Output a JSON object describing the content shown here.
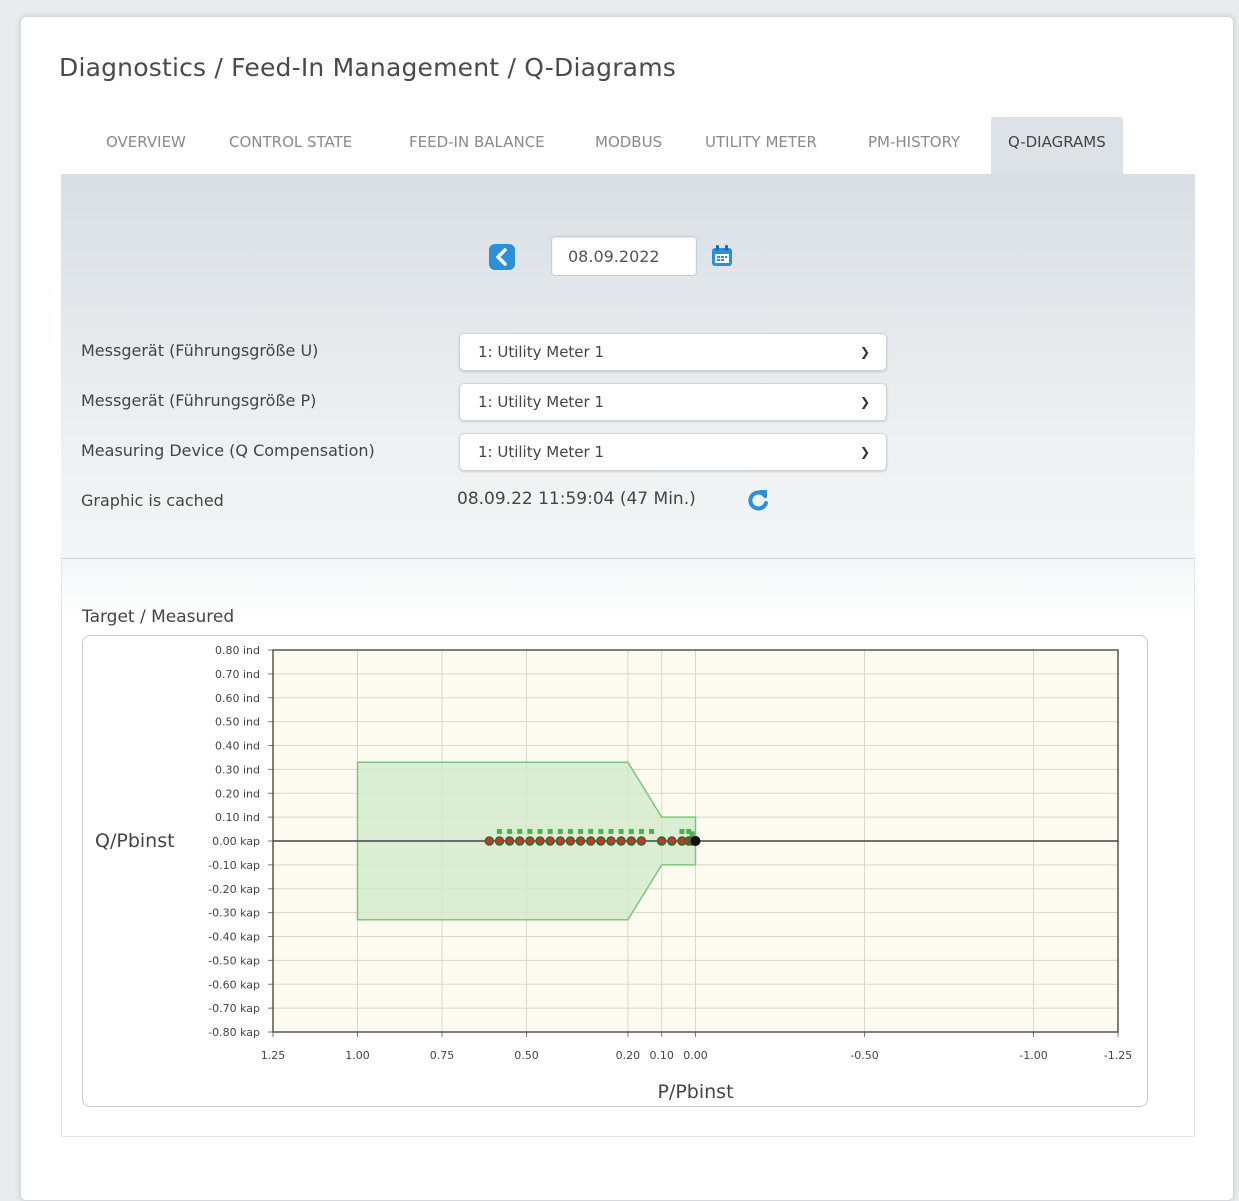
{
  "breadcrumb": "Diagnostics / Feed-In Management / Q-Diagrams",
  "tabs": [
    {
      "label": "OVERVIEW",
      "active": false
    },
    {
      "label": "CONTROL STATE",
      "active": false
    },
    {
      "label": "FEED-IN BALANCE",
      "active": false
    },
    {
      "label": "MODBUS",
      "active": false
    },
    {
      "label": "UTILITY METER",
      "active": false
    },
    {
      "label": "PM-HISTORY",
      "active": false
    },
    {
      "label": "Q-DIAGRAMS",
      "active": true
    }
  ],
  "date_nav": {
    "prev_icon": "chevron-left-icon",
    "date_value": "08.09.2022",
    "calendar_icon": "calendar-icon"
  },
  "settings": {
    "meter_u": {
      "label": "Messgerät (Führungsgröße U)",
      "value": "1: Utility Meter 1"
    },
    "meter_p": {
      "label": "Messgerät (Führungsgröße P)",
      "value": "1: Utility Meter 1"
    },
    "meter_q": {
      "label": "Measuring Device (Q Compensation)",
      "value": "1: Utility Meter 1"
    },
    "cached": {
      "label": "Graphic is cached",
      "value": "08.09.22 11:59:04 (47 Min.)",
      "refresh_icon": "refresh-icon"
    }
  },
  "colors": {
    "accent": "#2b8fdc",
    "target_fill": "#cfe8c8",
    "target_stroke": "#7cc67c",
    "measured_point": "#c0392b",
    "target_point": "#4caf50"
  },
  "chart_data": {
    "type": "scatter",
    "title": "Target / Measured",
    "xlabel": "P/Pbinst",
    "ylabel": "Q/Pbinst",
    "x_reversed": true,
    "xlim": [
      1.25,
      -1.25
    ],
    "ylim": [
      -0.8,
      0.8
    ],
    "x_ticks": [
      {
        "value": 1.25,
        "label": "1.25"
      },
      {
        "value": 1.0,
        "label": "1.00"
      },
      {
        "value": 0.75,
        "label": "0.75"
      },
      {
        "value": 0.5,
        "label": "0.50"
      },
      {
        "value": 0.2,
        "label": "0.20"
      },
      {
        "value": 0.1,
        "label": "0.10"
      },
      {
        "value": 0.0,
        "label": "0.00"
      },
      {
        "value": -0.5,
        "label": "-0.50"
      },
      {
        "value": -1.0,
        "label": "-1.00"
      },
      {
        "value": -1.25,
        "label": "-1.25"
      }
    ],
    "y_ticks": [
      {
        "value": 0.8,
        "label": "0.80 ind"
      },
      {
        "value": 0.7,
        "label": "0.70 ind"
      },
      {
        "value": 0.6,
        "label": "0.60 ind"
      },
      {
        "value": 0.5,
        "label": "0.50 ind"
      },
      {
        "value": 0.4,
        "label": "0.40 ind"
      },
      {
        "value": 0.3,
        "label": "0.30 ind"
      },
      {
        "value": 0.2,
        "label": "0.20 ind"
      },
      {
        "value": 0.1,
        "label": "0.10 ind"
      },
      {
        "value": 0.0,
        "label": "0.00 kap"
      },
      {
        "value": -0.1,
        "label": "-0.10 kap"
      },
      {
        "value": -0.2,
        "label": "-0.20 kap"
      },
      {
        "value": -0.3,
        "label": "-0.30 kap"
      },
      {
        "value": -0.4,
        "label": "-0.40 kap"
      },
      {
        "value": -0.5,
        "label": "-0.50 kap"
      },
      {
        "value": -0.6,
        "label": "-0.60 kap"
      },
      {
        "value": -0.7,
        "label": "-0.70 kap"
      },
      {
        "value": -0.8,
        "label": "-0.80 kap"
      }
    ],
    "target_region": [
      [
        1.0,
        0.33
      ],
      [
        0.2,
        0.33
      ],
      [
        0.1,
        0.1
      ],
      [
        0.0,
        0.1
      ],
      [
        0.0,
        -0.1
      ],
      [
        0.1,
        -0.1
      ],
      [
        0.2,
        -0.33
      ],
      [
        1.0,
        -0.33
      ]
    ],
    "series": [
      {
        "kind": "target",
        "points": [
          [
            0.58,
            0.04
          ],
          [
            0.55,
            0.04
          ],
          [
            0.52,
            0.04
          ],
          [
            0.49,
            0.04
          ],
          [
            0.46,
            0.04
          ],
          [
            0.43,
            0.04
          ],
          [
            0.4,
            0.04
          ],
          [
            0.37,
            0.04
          ],
          [
            0.34,
            0.04
          ],
          [
            0.31,
            0.04
          ],
          [
            0.28,
            0.04
          ],
          [
            0.25,
            0.04
          ],
          [
            0.22,
            0.04
          ],
          [
            0.19,
            0.04
          ],
          [
            0.16,
            0.04
          ],
          [
            0.13,
            0.04
          ],
          [
            0.04,
            0.04
          ],
          [
            0.02,
            0.04
          ],
          [
            0.01,
            0.03
          ]
        ]
      },
      {
        "kind": "measured",
        "points": [
          [
            0.61,
            0.0
          ],
          [
            0.58,
            0.0
          ],
          [
            0.55,
            0.0
          ],
          [
            0.52,
            0.0
          ],
          [
            0.49,
            0.0
          ],
          [
            0.46,
            0.0
          ],
          [
            0.43,
            0.0
          ],
          [
            0.4,
            0.0
          ],
          [
            0.37,
            0.0
          ],
          [
            0.34,
            0.0
          ],
          [
            0.31,
            0.0
          ],
          [
            0.28,
            0.0
          ],
          [
            0.25,
            0.0
          ],
          [
            0.22,
            0.0
          ],
          [
            0.19,
            0.0
          ],
          [
            0.16,
            0.0
          ],
          [
            0.1,
            0.0
          ],
          [
            0.07,
            0.0
          ],
          [
            0.04,
            0.0
          ],
          [
            0.02,
            0.0
          ],
          [
            0.01,
            0.0
          ],
          [
            0.0,
            0.0
          ]
        ]
      }
    ]
  }
}
